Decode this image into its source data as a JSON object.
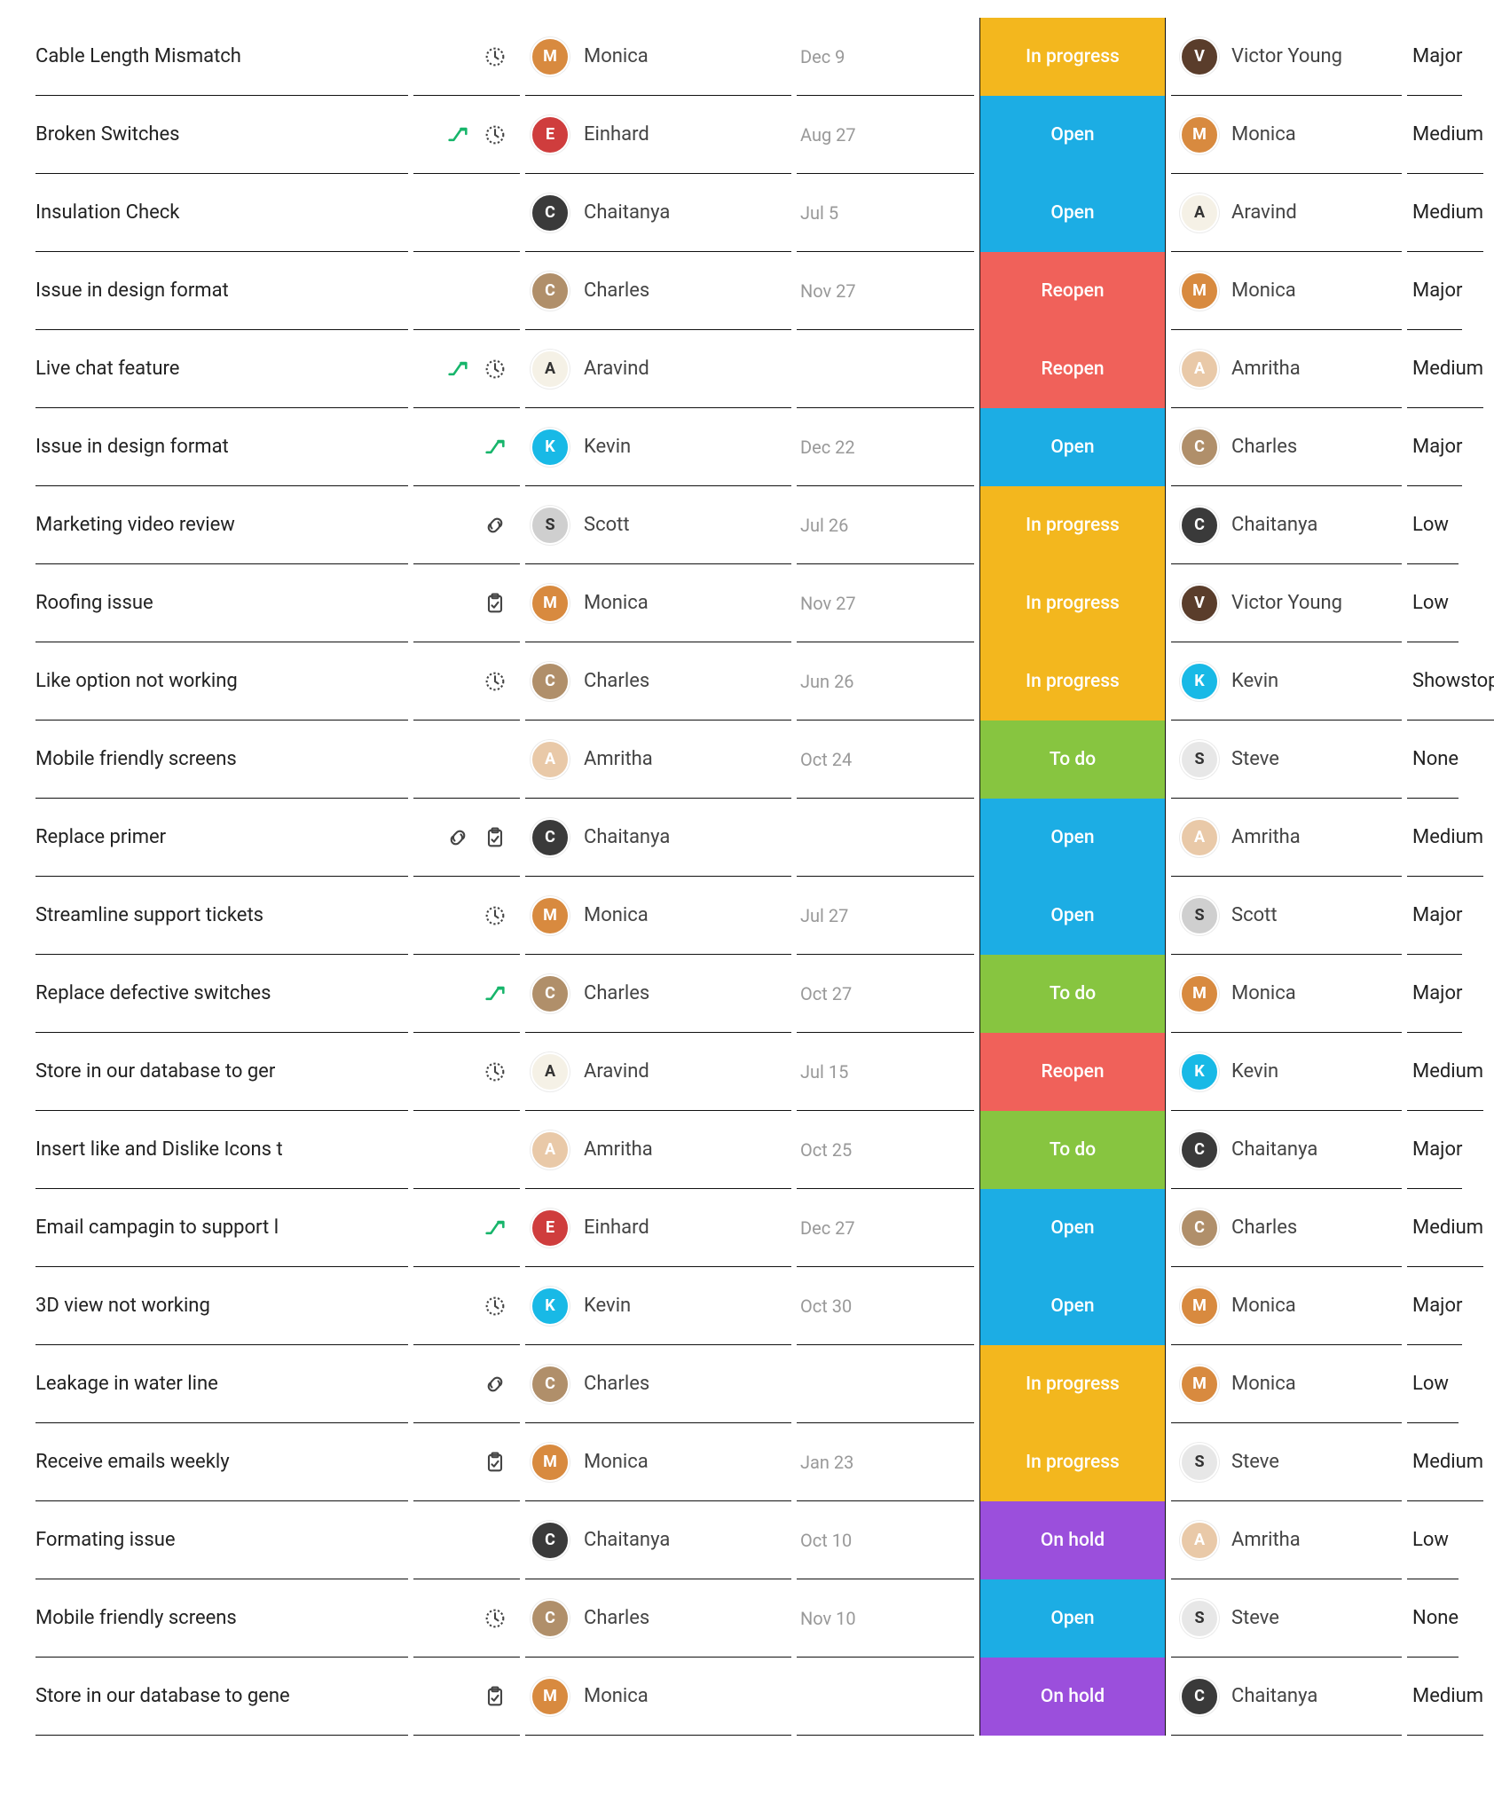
{
  "status_colors": {
    "In progress": "st-in-progress",
    "Open": "st-open",
    "Reopen": "st-reopen",
    "To do": "st-to-do",
    "On hold": "st-on-hold"
  },
  "rows": [
    {
      "title": "Cable Length Mismatch",
      "icons": [
        "clock"
      ],
      "assignee": "Monica",
      "date": "Dec 9",
      "status": "In progress",
      "reporter": "Victor Young",
      "priority": "Major"
    },
    {
      "title": "Broken Switches",
      "icons": [
        "escalator",
        "clock"
      ],
      "assignee": "Einhard",
      "date": "Aug 27",
      "status": "Open",
      "reporter": "Monica",
      "priority": "Medium"
    },
    {
      "title": "Insulation Check",
      "icons": [],
      "assignee": "Chaitanya",
      "date": "Jul 5",
      "status": "Open",
      "reporter": "Aravind",
      "priority": "Medium"
    },
    {
      "title": "Issue in design format",
      "icons": [],
      "assignee": "Charles",
      "date": "Nov 27",
      "status": "Reopen",
      "reporter": "Monica",
      "priority": "Major"
    },
    {
      "title": "Live chat feature",
      "icons": [
        "escalator",
        "clock"
      ],
      "assignee": "Aravind",
      "date": "",
      "status": "Reopen",
      "reporter": "Amritha",
      "priority": "Medium"
    },
    {
      "title": "Issue in design format",
      "icons": [
        "escalator"
      ],
      "assignee": "Kevin",
      "date": "Dec 22",
      "status": "Open",
      "reporter": "Charles",
      "priority": "Major"
    },
    {
      "title": "Marketing video review",
      "icons": [
        "link"
      ],
      "assignee": "Scott",
      "date": "Jul 26",
      "status": "In progress",
      "reporter": "Chaitanya",
      "priority": "Low"
    },
    {
      "title": "Roofing issue",
      "icons": [
        "clipboard"
      ],
      "assignee": "Monica",
      "date": "Nov 27",
      "status": "In progress",
      "reporter": "Victor Young",
      "priority": "Low"
    },
    {
      "title": "Like option not working",
      "icons": [
        "clock"
      ],
      "assignee": "Charles",
      "date": "Jun 26",
      "status": "In progress",
      "reporter": "Kevin",
      "priority": "Showstopper"
    },
    {
      "title": "Mobile friendly screens",
      "icons": [],
      "assignee": "Amritha",
      "date": "Oct 24",
      "status": "To do",
      "reporter": "Steve",
      "priority": "None"
    },
    {
      "title": "Replace primer",
      "icons": [
        "link",
        "clipboard"
      ],
      "assignee": "Chaitanya",
      "date": "",
      "status": "Open",
      "reporter": "Amritha",
      "priority": "Medium"
    },
    {
      "title": "Streamline support tickets",
      "icons": [
        "clock"
      ],
      "assignee": "Monica",
      "date": "Jul 27",
      "status": "Open",
      "reporter": "Scott",
      "priority": "Major"
    },
    {
      "title": "Replace defective switches",
      "icons": [
        "escalator"
      ],
      "assignee": "Charles",
      "date": "Oct 27",
      "status": "To do",
      "reporter": "Monica",
      "priority": "Major"
    },
    {
      "title": "Store in our database to ger",
      "icons": [
        "clock"
      ],
      "assignee": "Aravind",
      "date": "Jul 15",
      "status": "Reopen",
      "reporter": "Kevin",
      "priority": "Medium"
    },
    {
      "title": "Insert like and Dislike Icons t",
      "icons": [],
      "assignee": "Amritha",
      "date": "Oct 25",
      "status": "To do",
      "reporter": "Chaitanya",
      "priority": "Major"
    },
    {
      "title": "Email campagin to support l",
      "icons": [
        "escalator"
      ],
      "assignee": "Einhard",
      "date": "Dec 27",
      "status": "Open",
      "reporter": "Charles",
      "priority": "Medium"
    },
    {
      "title": "3D view not working",
      "icons": [
        "clock"
      ],
      "assignee": "Kevin",
      "date": "Oct 30",
      "status": "Open",
      "reporter": "Monica",
      "priority": "Major"
    },
    {
      "title": "Leakage in water line",
      "icons": [
        "link"
      ],
      "assignee": "Charles",
      "date": "",
      "status": "In progress",
      "reporter": "Monica",
      "priority": "Low"
    },
    {
      "title": "Receive emails weekly",
      "icons": [
        "clipboard"
      ],
      "assignee": "Monica",
      "date": "Jan 23",
      "status": "In progress",
      "reporter": "Steve",
      "priority": "Medium"
    },
    {
      "title": "Formating issue",
      "icons": [],
      "assignee": "Chaitanya",
      "date": "Oct 10",
      "status": "On hold",
      "reporter": "Amritha",
      "priority": "Low"
    },
    {
      "title": "Mobile friendly screens",
      "icons": [
        "clock"
      ],
      "assignee": "Charles",
      "date": "Nov 10",
      "status": "Open",
      "reporter": "Steve",
      "priority": "None"
    },
    {
      "title": "Store in our database to gene",
      "icons": [
        "clipboard"
      ],
      "assignee": "Monica",
      "date": "",
      "status": "On hold",
      "reporter": "Chaitanya",
      "priority": "Medium"
    }
  ]
}
